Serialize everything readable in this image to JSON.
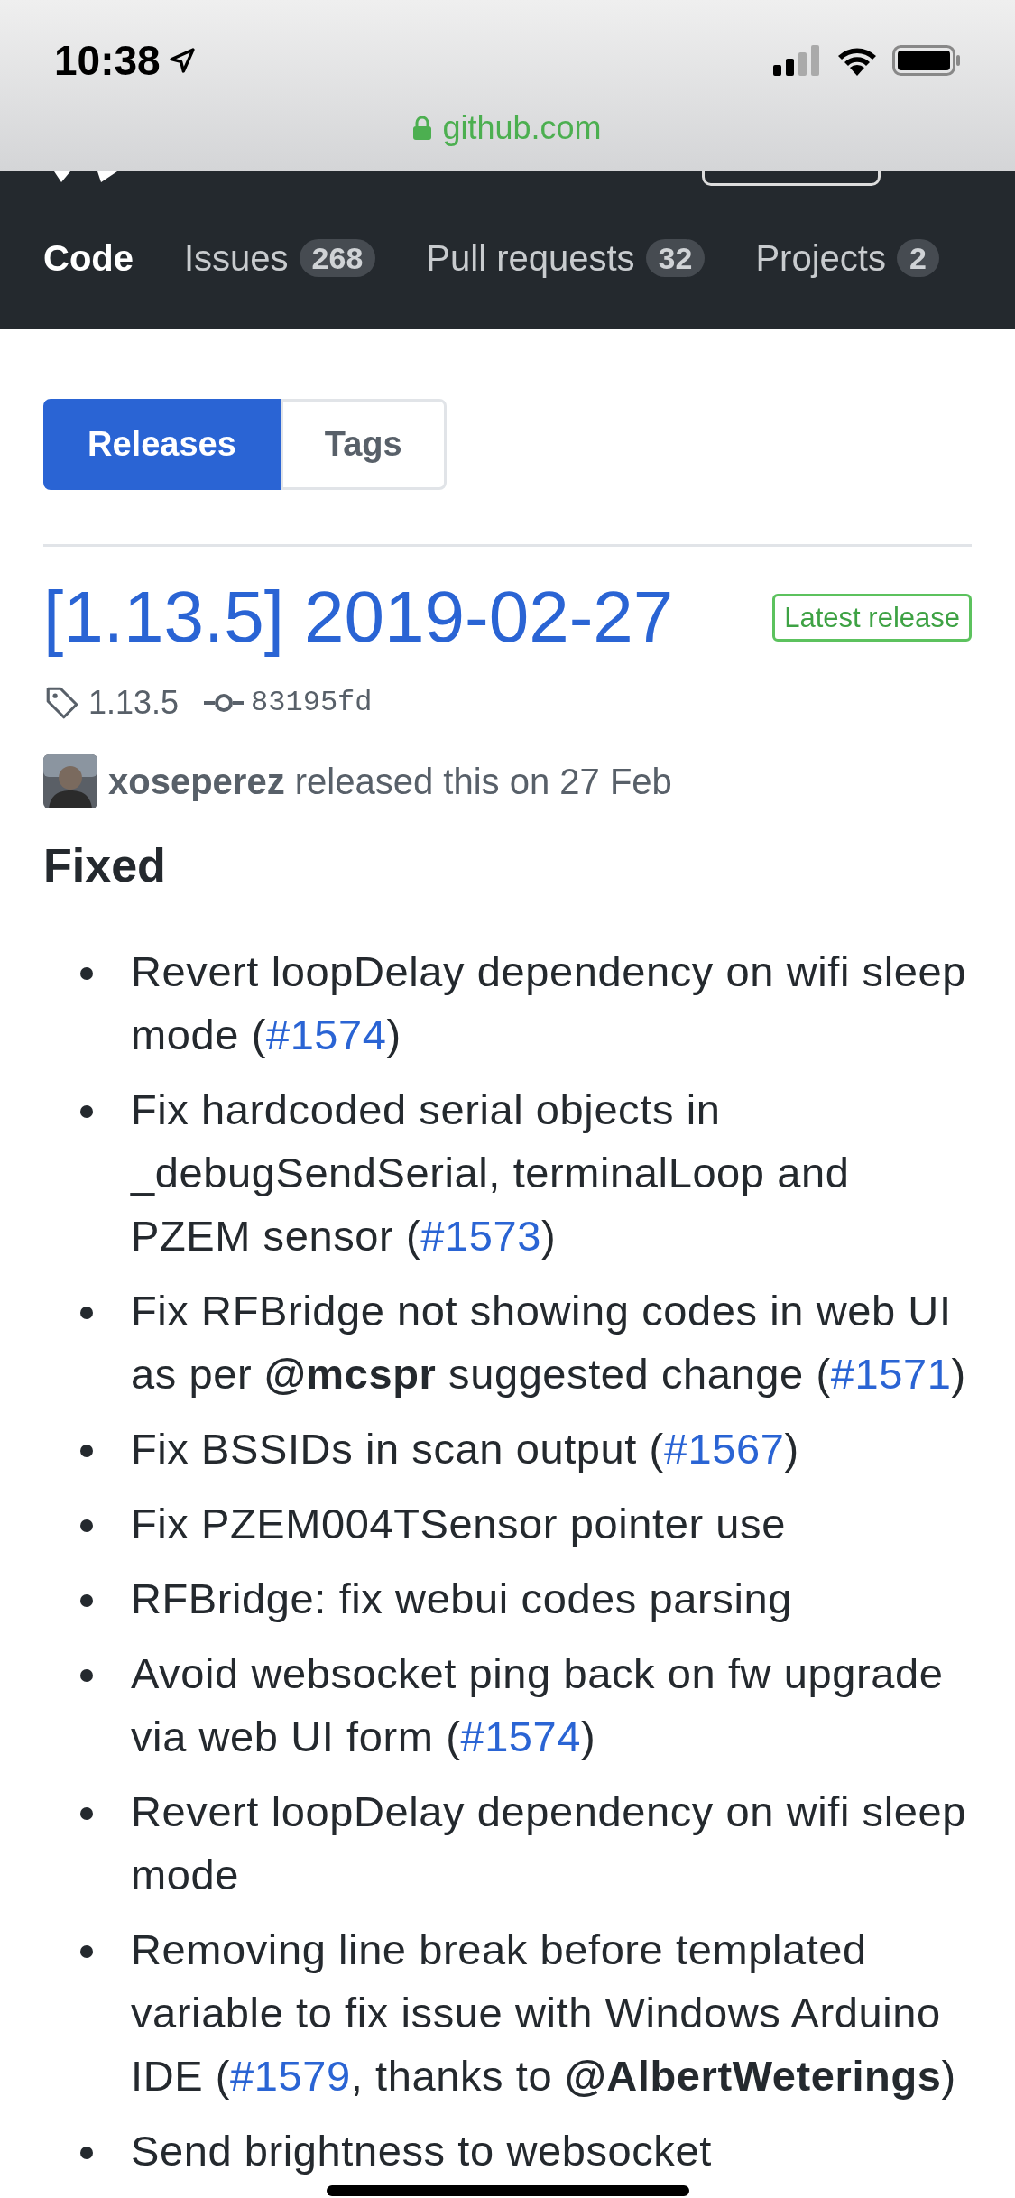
{
  "status_bar": {
    "time": "10:38"
  },
  "address_bar": {
    "url": "github.com"
  },
  "repo_tabs": [
    {
      "label": "Code",
      "selected": true
    },
    {
      "label": "Issues",
      "count": "268",
      "selected": false
    },
    {
      "label": "Pull requests",
      "count": "32",
      "selected": false
    },
    {
      "label": "Projects",
      "count": "2",
      "selected": false
    }
  ],
  "view_toggle": [
    {
      "label": "Releases",
      "selected": true
    },
    {
      "label": "Tags",
      "selected": false
    }
  ],
  "release": {
    "title": "[1.13.5] 2019-02-27",
    "badge": "Latest release",
    "tag": "1.13.5",
    "commit": "83195fd",
    "author": "xoseperez",
    "released_text": "released this on 27 Feb",
    "heading": "Fixed",
    "items": [
      [
        {
          "kind": "text",
          "text": "Revert loopDelay dependency on wifi sleep mode ("
        },
        {
          "kind": "link",
          "text": "#1574"
        },
        {
          "kind": "text",
          "text": ")"
        }
      ],
      [
        {
          "kind": "text",
          "text": "Fix hardcoded serial objects in _debugSendSerial, terminalLoop and PZEM sensor ("
        },
        {
          "kind": "link",
          "text": "#1573"
        },
        {
          "kind": "text",
          "text": ")"
        }
      ],
      [
        {
          "kind": "text",
          "text": "Fix RFBridge not showing codes in web UI as per **@mcspr** suggested change ("
        },
        {
          "kind": "link",
          "text": "#1571"
        },
        {
          "kind": "text",
          "text": ")"
        }
      ],
      [
        {
          "kind": "text",
          "text": "Fix BSSIDs in scan output ("
        },
        {
          "kind": "link",
          "text": "#1567"
        },
        {
          "kind": "text",
          "text": ")"
        }
      ],
      [
        {
          "kind": "text",
          "text": "Fix PZEM004TSensor pointer use"
        }
      ],
      [
        {
          "kind": "text",
          "text": "RFBridge: fix webui codes parsing"
        }
      ],
      [
        {
          "kind": "text",
          "text": "Avoid websocket ping back on fw upgrade via web UI form ("
        },
        {
          "kind": "link",
          "text": "#1574"
        },
        {
          "kind": "text",
          "text": ")"
        }
      ],
      [
        {
          "kind": "text",
          "text": "Revert loopDelay dependency on wifi sleep mode"
        }
      ],
      [
        {
          "kind": "text",
          "text": "Removing line break before templated variable to fix issue with Windows Arduino IDE ("
        },
        {
          "kind": "link",
          "text": "#1579"
        },
        {
          "kind": "text",
          "text": ", thanks to **@AlbertWeterings**)"
        }
      ],
      [
        {
          "kind": "text",
          "text": "Send brightness to websocket"
        }
      ]
    ]
  }
}
